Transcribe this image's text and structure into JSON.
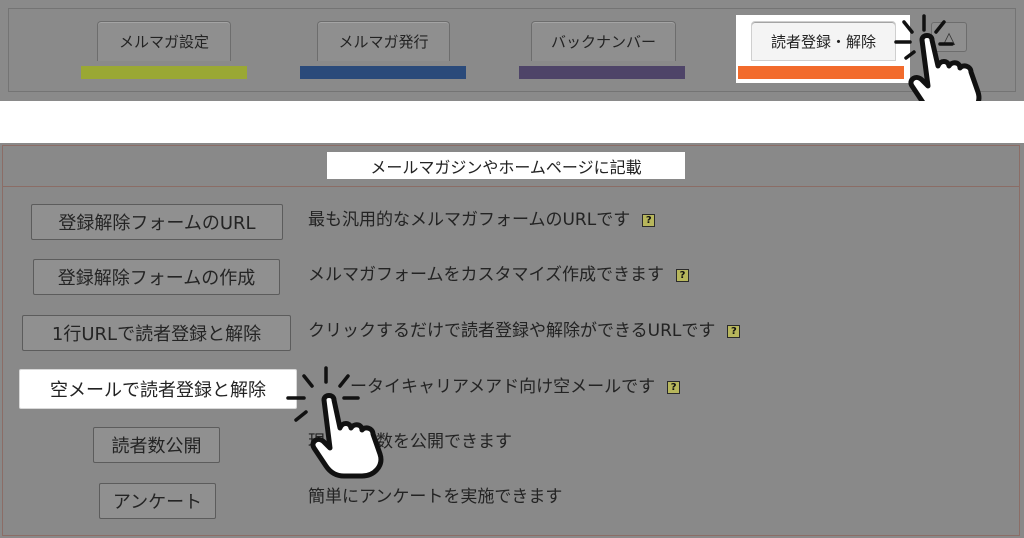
{
  "tabs": [
    {
      "label": "メルマガ設定",
      "color": "#9aa834"
    },
    {
      "label": "メルマガ発行",
      "color": "#2a4a7a"
    },
    {
      "label": "バックナンバー",
      "color": "#4e4468"
    },
    {
      "label": "読者登録・解除",
      "color": "#f26b2c"
    }
  ],
  "triangle_symbol": "△",
  "panel": {
    "title": "メールマガジンやホームページに記載",
    "rows": [
      {
        "button": "登録解除フォームのURL",
        "desc": "最も汎用的なメルマガフォームのURLです",
        "help": "?"
      },
      {
        "button": "登録解除フォームの作成",
        "desc": "メルマガフォームをカスタマイズ作成できます",
        "help": "?"
      },
      {
        "button": "1行URLで読者登録と解除",
        "desc": "クリックするだけで読者登録や解除ができるURLです",
        "help": "?"
      },
      {
        "button": "空メールで読者登録と解除",
        "desc": "ータイキャリアメアド向け空メールです",
        "help": "?"
      },
      {
        "button": "読者数公開",
        "desc": "現　　者数を公開できます",
        "help": ""
      },
      {
        "button": "アンケート",
        "desc": "簡単にアンケートを実施できます",
        "help": ""
      }
    ]
  },
  "icons": [
    "pointing-hand-cursor-icon",
    "help-icon",
    "triangle-icon"
  ]
}
